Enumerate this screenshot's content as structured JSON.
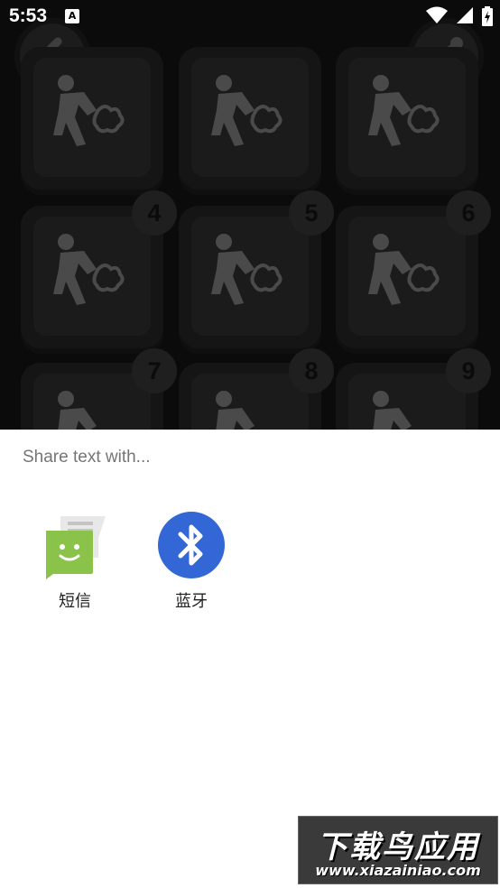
{
  "status_bar": {
    "time": "5:53",
    "notification_icon_letter": "A",
    "icons": [
      "wifi-icon",
      "signal-icon",
      "battery-charging-icon"
    ]
  },
  "app": {
    "back_icon": "chevron-left-icon",
    "share_icon": "share-icon",
    "tiles": [
      {
        "badge": ""
      },
      {
        "badge": ""
      },
      {
        "badge": ""
      },
      {
        "badge": "4"
      },
      {
        "badge": "5"
      },
      {
        "badge": "6"
      },
      {
        "badge": "7"
      },
      {
        "badge": "8"
      },
      {
        "badge": "9"
      }
    ],
    "colors": {
      "overlay": "#0b0b0b",
      "tile": "#151515",
      "figure": "#4a4a4a"
    }
  },
  "share_sheet": {
    "title": "Share text with...",
    "targets": [
      {
        "label": "短信",
        "icon": "messaging-app-icon",
        "color": "#8bc34a"
      },
      {
        "label": "蓝牙",
        "icon": "bluetooth-icon",
        "color": "#3367d6"
      }
    ]
  },
  "watermark": {
    "line1": "下载鸟应用",
    "line2": "www.xiazainiao.com"
  }
}
